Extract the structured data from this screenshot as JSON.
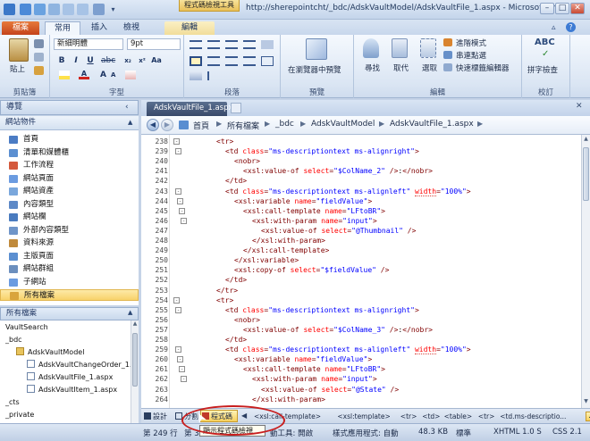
{
  "titlebar": {
    "context_tool": "程式碼檢視工具",
    "window_title": "http://sherepointcht/_bdc/AdskVaultModel/AdskVaultFile_1.aspx - Microsoft Sha...",
    "controls": [
      "–",
      "□",
      "✕"
    ]
  },
  "tabs": {
    "file": "檔案",
    "home": "常用",
    "insert": "插入",
    "view": "檢視",
    "edit": "編輯"
  },
  "ribbon": {
    "clipboard": {
      "paste": "貼上",
      "group_label": "剪貼簿"
    },
    "font": {
      "font_name": "新細明體",
      "font_size": "9pt",
      "group_label": "字型"
    },
    "paragraph": {
      "group_label": "段落"
    },
    "preview": {
      "preview_button": "在瀏覽器中預覽",
      "group_label": "預覽"
    },
    "editing": {
      "find": "尋找",
      "replace": "取代",
      "select": "選取",
      "advanced_mode": "進階模式",
      "skewer_click": "串連點選",
      "quick_tag_editor": "快速標籤編輯器",
      "group_label": "編輯"
    },
    "proofing": {
      "spelling": "拼字檢查",
      "group_label": "校訂"
    }
  },
  "navigation": {
    "header": "導覽",
    "subheader": "網站物件",
    "items": [
      {
        "label": "首頁",
        "color": "#4b7cc4"
      },
      {
        "label": "清單和媒體櫃",
        "color": "#5b8fd1"
      },
      {
        "label": "工作流程",
        "color": "#d4593c"
      },
      {
        "label": "網站頁面",
        "color": "#6b9be0"
      },
      {
        "label": "網站資產",
        "color": "#7aa7dc"
      },
      {
        "label": "內容類型",
        "color": "#5d89c7"
      },
      {
        "label": "網站欄",
        "color": "#4a7bbf"
      },
      {
        "label": "外部內容類型",
        "color": "#6f95c9"
      },
      {
        "label": "資料來源",
        "color": "#c08a3c"
      },
      {
        "label": "主版頁面",
        "color": "#5b8fd1"
      },
      {
        "label": "網站群組",
        "color": "#6c8fbe"
      },
      {
        "label": "子網站",
        "color": "#6b9be0"
      },
      {
        "label": "所有檔案",
        "color": "#d9a43c"
      }
    ],
    "selected": "所有檔案"
  },
  "all_files": {
    "header": "所有檔案",
    "tree": [
      {
        "label": "VaultSearch",
        "indent": 0,
        "icon": "none"
      },
      {
        "label": "_bdc",
        "indent": 0,
        "icon": "none"
      },
      {
        "label": "AdskVaultModel",
        "indent": 1,
        "icon": "folder"
      },
      {
        "label": "AdskVaultChangeOrder_1.aspx",
        "indent": 2,
        "icon": "page"
      },
      {
        "label": "AdskVaultFile_1.aspx",
        "indent": 2,
        "icon": "page"
      },
      {
        "label": "AdskVaultItem_1.aspx",
        "indent": 2,
        "icon": "page"
      },
      {
        "label": "_cts",
        "indent": 0,
        "icon": "none"
      },
      {
        "label": "_private",
        "indent": 0,
        "icon": "none"
      }
    ]
  },
  "editor": {
    "tab_label": "AdskVaultFile_1.aspx",
    "breadcrumb": [
      "首頁",
      "所有檔案",
      "_bdc",
      "AdskVaultModel",
      "AdskVaultFile_1.aspx"
    ],
    "lines": [
      {
        "n": "238",
        "indent": 0,
        "parts": [
          [
            "t",
            "<tr>"
          ]
        ]
      },
      {
        "n": "239",
        "indent": 1,
        "parts": [
          [
            "t",
            "<td "
          ],
          [
            "a",
            "class"
          ],
          [
            "t",
            "="
          ],
          [
            "v",
            "\"ms-descriptiontext ms-alignright\""
          ],
          [
            "t",
            ">"
          ]
        ]
      },
      {
        "n": "240",
        "indent": 2,
        "parts": [
          [
            "t",
            "<nobr>"
          ]
        ]
      },
      {
        "n": "241",
        "indent": 3,
        "parts": [
          [
            "t",
            "<xsl:value-of "
          ],
          [
            "a",
            "select"
          ],
          [
            "t",
            "="
          ],
          [
            "v",
            "\"$ColName_2\""
          ],
          [
            "t",
            " />"
          ],
          [
            "p",
            ":"
          ],
          [
            "t",
            "</nobr>"
          ]
        ]
      },
      {
        "n": "242",
        "indent": 1,
        "parts": [
          [
            "t",
            "</td>"
          ]
        ]
      },
      {
        "n": "243",
        "indent": 1,
        "parts": [
          [
            "t",
            "<td "
          ],
          [
            "a",
            "class"
          ],
          [
            "t",
            "="
          ],
          [
            "v",
            "\"ms-descriptiontext ms-alignleft\""
          ],
          [
            "t",
            " "
          ],
          [
            "a",
            "width"
          ],
          [
            "t",
            "="
          ],
          [
            "v",
            "\"100%\""
          ],
          [
            "t",
            ">"
          ]
        ]
      },
      {
        "n": "244",
        "indent": 2,
        "parts": [
          [
            "t",
            "<xsl:variable "
          ],
          [
            "a",
            "name"
          ],
          [
            "t",
            "="
          ],
          [
            "v",
            "\"fieldValue\""
          ],
          [
            "t",
            ">"
          ]
        ]
      },
      {
        "n": "245",
        "indent": 3,
        "parts": [
          [
            "t",
            "<xsl:call-template "
          ],
          [
            "a",
            "name"
          ],
          [
            "t",
            "="
          ],
          [
            "v",
            "\"LFtoBR\""
          ],
          [
            "t",
            ">"
          ]
        ]
      },
      {
        "n": "246",
        "indent": 4,
        "parts": [
          [
            "t",
            "<xsl:with-param "
          ],
          [
            "a",
            "name"
          ],
          [
            "t",
            "="
          ],
          [
            "v",
            "\"input\""
          ],
          [
            "t",
            ">"
          ]
        ]
      },
      {
        "n": "247",
        "indent": 5,
        "parts": [
          [
            "t",
            "<xsl:value-of "
          ],
          [
            "a",
            "select"
          ],
          [
            "t",
            "="
          ],
          [
            "v",
            "\"@Thumbnail\""
          ],
          [
            "t",
            " />"
          ]
        ]
      },
      {
        "n": "248",
        "indent": 4,
        "parts": [
          [
            "t",
            "</xsl:with-param>"
          ]
        ]
      },
      {
        "n": "249",
        "indent": 3,
        "parts": [
          [
            "t",
            "</xsl:call-template>"
          ]
        ]
      },
      {
        "n": "250",
        "indent": 2,
        "parts": [
          [
            "t",
            "</xsl:variable>"
          ]
        ]
      },
      {
        "n": "251",
        "indent": 2,
        "parts": [
          [
            "t",
            "<xsl:copy-of "
          ],
          [
            "a",
            "select"
          ],
          [
            "t",
            "="
          ],
          [
            "v",
            "\"$fieldValue\""
          ],
          [
            "t",
            " />"
          ]
        ]
      },
      {
        "n": "252",
        "indent": 1,
        "parts": [
          [
            "t",
            "</td>"
          ]
        ]
      },
      {
        "n": "253",
        "indent": 0,
        "parts": [
          [
            "t",
            "</tr>"
          ]
        ]
      },
      {
        "n": "254",
        "indent": 0,
        "parts": [
          [
            "t",
            "<tr>"
          ]
        ]
      },
      {
        "n": "255",
        "indent": 1,
        "parts": [
          [
            "t",
            "<td "
          ],
          [
            "a",
            "class"
          ],
          [
            "t",
            "="
          ],
          [
            "v",
            "\"ms-descriptiontext ms-alignright\""
          ],
          [
            "t",
            ">"
          ]
        ]
      },
      {
        "n": "256",
        "indent": 2,
        "parts": [
          [
            "t",
            "<nobr>"
          ]
        ]
      },
      {
        "n": "257",
        "indent": 3,
        "parts": [
          [
            "t",
            "<xsl:value-of "
          ],
          [
            "a",
            "select"
          ],
          [
            "t",
            "="
          ],
          [
            "v",
            "\"$ColName_3\""
          ],
          [
            "t",
            " />"
          ],
          [
            "p",
            ":"
          ],
          [
            "t",
            "</nobr>"
          ]
        ]
      },
      {
        "n": "258",
        "indent": 1,
        "parts": [
          [
            "t",
            "</td>"
          ]
        ]
      },
      {
        "n": "259",
        "indent": 1,
        "parts": [
          [
            "t",
            "<td "
          ],
          [
            "a",
            "class"
          ],
          [
            "t",
            "="
          ],
          [
            "v",
            "\"ms-descriptiontext ms-alignleft\""
          ],
          [
            "t",
            " "
          ],
          [
            "a",
            "width"
          ],
          [
            "t",
            "="
          ],
          [
            "v",
            "\"100%\""
          ],
          [
            "t",
            ">"
          ]
        ]
      },
      {
        "n": "260",
        "indent": 2,
        "parts": [
          [
            "t",
            "<xsl:variable "
          ],
          [
            "a",
            "name"
          ],
          [
            "t",
            "="
          ],
          [
            "v",
            "\"fieldValue\""
          ],
          [
            "t",
            ">"
          ]
        ]
      },
      {
        "n": "261",
        "indent": 3,
        "parts": [
          [
            "t",
            "<xsl:call-template "
          ],
          [
            "a",
            "name"
          ],
          [
            "t",
            "="
          ],
          [
            "v",
            "\"LFtoBR\""
          ],
          [
            "t",
            ">"
          ]
        ]
      },
      {
        "n": "262",
        "indent": 4,
        "parts": [
          [
            "t",
            "<xsl:with-param "
          ],
          [
            "a",
            "name"
          ],
          [
            "t",
            "="
          ],
          [
            "v",
            "\"input\""
          ],
          [
            "t",
            ">"
          ]
        ]
      },
      {
        "n": "263",
        "indent": 5,
        "parts": [
          [
            "t",
            "<xsl:value-of "
          ],
          [
            "a",
            "select"
          ],
          [
            "t",
            "="
          ],
          [
            "v",
            "\"@State\""
          ],
          [
            "t",
            " />"
          ]
        ]
      },
      {
        "n": "264",
        "indent": 4,
        "parts": [
          [
            "t",
            "</xsl:with-param>"
          ]
        ]
      }
    ]
  },
  "viewbar": {
    "design": "設計",
    "split": "分割",
    "code": "程式碼",
    "tag_crumbs": [
      "<xsl:call-template>",
      "<xsl:template>",
      "<tr>",
      "<td>",
      "<table>",
      "<tr>",
      "<td.ms-descriptio...",
      "<xsl:value-of>"
    ]
  },
  "statusbar": {
    "line": "第 249 行",
    "col": "第 37",
    "tooltip": "顯示程式碼檢視",
    "auto_fill": "動工具: 開啟",
    "style_app": "樣式應用程式: 自動",
    "size": "48.3 KB",
    "standard": "標準",
    "doctype": "XHTML 1.0 S",
    "css": "CSS 2.1"
  }
}
